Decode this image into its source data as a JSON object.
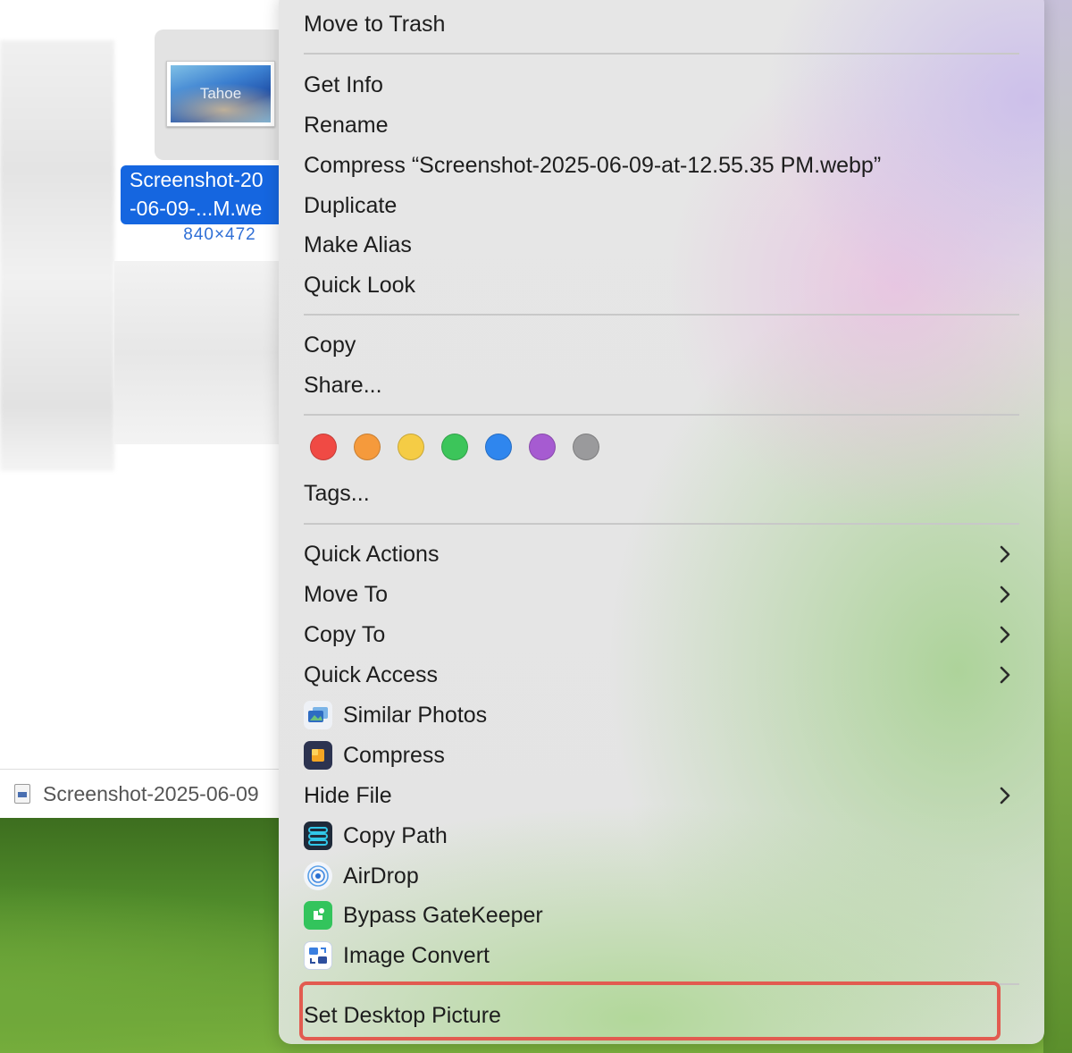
{
  "finder": {
    "thumbnail_text": "Tahoe",
    "file_label_line1": "Screenshot-20",
    "file_label_line2": "-06-09-...M.we",
    "file_dims": "840×472",
    "path_bar_text": "Screenshot-2025-06-09"
  },
  "menu": {
    "move_to_trash": "Move to Trash",
    "get_info": "Get Info",
    "rename": "Rename",
    "compress_file": "Compress “Screenshot-2025-06-09-at-12.55.35 PM.webp”",
    "duplicate": "Duplicate",
    "make_alias": "Make Alias",
    "quick_look": "Quick Look",
    "copy": "Copy",
    "share": "Share...",
    "tags": "Tags...",
    "quick_actions": "Quick Actions",
    "move_to": "Move To",
    "copy_to": "Copy To",
    "quick_access": "Quick Access",
    "similar_photos": "Similar Photos",
    "compress": "Compress",
    "hide_file": "Hide File",
    "copy_path": "Copy Path",
    "airdrop": "AirDrop",
    "bypass_gatekeeper": "Bypass GateKeeper",
    "image_convert": "Image Convert",
    "set_desktop_picture": "Set Desktop Picture"
  },
  "tag_colors": [
    "#f04a44",
    "#f59a3c",
    "#f5cc45",
    "#3cc55a",
    "#2f86ee",
    "#a65bd1",
    "#9a9a9c"
  ],
  "colors": {
    "selection_blue": "#1566e0",
    "highlight_red": "#e25b50"
  }
}
